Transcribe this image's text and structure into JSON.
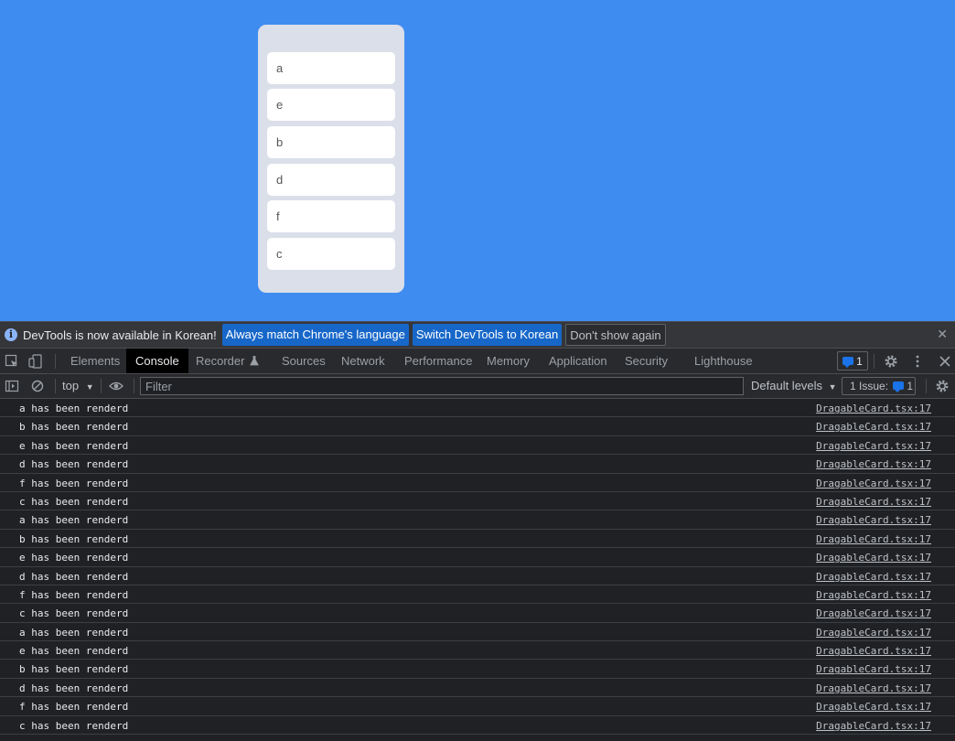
{
  "board": {
    "cards": [
      "a",
      "e",
      "b",
      "d",
      "f",
      "c"
    ]
  },
  "infobar": {
    "message": "DevTools is now available in Korean!",
    "buttons": [
      "Always match Chrome's language",
      "Switch DevTools to Korean",
      "Don't show again"
    ],
    "close": "✕"
  },
  "tabs": {
    "items": [
      "Elements",
      "Console",
      "Recorder",
      "Sources",
      "Network",
      "Performance",
      "Memory",
      "Application",
      "Security",
      "Lighthouse"
    ],
    "active": "Console",
    "issues_count": "1"
  },
  "console_toolbar": {
    "context": "top",
    "filter_placeholder": "Filter",
    "levels": "Default levels",
    "issue_text": "1 Issue:",
    "issue_count": "1"
  },
  "messages": [
    {
      "text": "a has been renderd",
      "source": "DragableCard.tsx:17"
    },
    {
      "text": "b has been renderd",
      "source": "DragableCard.tsx:17"
    },
    {
      "text": "e has been renderd",
      "source": "DragableCard.tsx:17"
    },
    {
      "text": "d has been renderd",
      "source": "DragableCard.tsx:17"
    },
    {
      "text": "f has been renderd",
      "source": "DragableCard.tsx:17"
    },
    {
      "text": "c has been renderd",
      "source": "DragableCard.tsx:17"
    },
    {
      "text": "a has been renderd",
      "source": "DragableCard.tsx:17"
    },
    {
      "text": "b has been renderd",
      "source": "DragableCard.tsx:17"
    },
    {
      "text": "e has been renderd",
      "source": "DragableCard.tsx:17"
    },
    {
      "text": "d has been renderd",
      "source": "DragableCard.tsx:17"
    },
    {
      "text": "f has been renderd",
      "source": "DragableCard.tsx:17"
    },
    {
      "text": "c has been renderd",
      "source": "DragableCard.tsx:17"
    },
    {
      "text": "a has been renderd",
      "source": "DragableCard.tsx:17"
    },
    {
      "text": "e has been renderd",
      "source": "DragableCard.tsx:17"
    },
    {
      "text": "b has been renderd",
      "source": "DragableCard.tsx:17"
    },
    {
      "text": "d has been renderd",
      "source": "DragableCard.tsx:17"
    },
    {
      "text": "f has been renderd",
      "source": "DragableCard.tsx:17"
    },
    {
      "text": "c has been renderd",
      "source": "DragableCard.tsx:17"
    }
  ]
}
